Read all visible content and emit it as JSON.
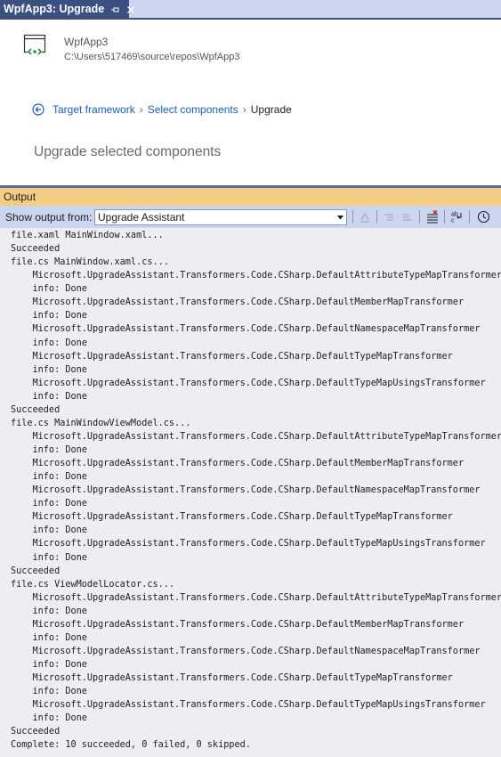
{
  "tab": {
    "title": "WpfApp3: Upgrade",
    "pin_icon": "pin-icon",
    "close_icon": "close-icon",
    "accent": "#3b4f81"
  },
  "project": {
    "icon": "wpf-project-icon",
    "name": "WpfApp3",
    "path": "C:\\Users\\517469\\source\\repos\\WpfApp3"
  },
  "breadcrumb": {
    "back_icon": "back-arrow-icon",
    "items": [
      "Target framework",
      "Select components",
      "Upgrade"
    ],
    "separator": "›"
  },
  "step_title": "Upgrade selected components",
  "output": {
    "title": "Output",
    "title_bg": "#f5cc84",
    "show_label": "Show output from:",
    "source": "Upgrade Assistant",
    "toolbar_icons": [
      "find-message-icon",
      "previous-message-icon",
      "next-message-icon",
      "clear-all-icon",
      "toggle-word-wrap-icon",
      "toggle-timestamp-icon"
    ],
    "lines": [
      "file.xaml MainWindow.xaml...",
      "Succeeded",
      "file.cs MainWindow.xaml.cs...",
      "    Microsoft.UpgradeAssistant.Transformers.Code.CSharp.DefaultAttributeTypeMapTransformer",
      "    info: Done",
      "    Microsoft.UpgradeAssistant.Transformers.Code.CSharp.DefaultMemberMapTransformer",
      "    info: Done",
      "    Microsoft.UpgradeAssistant.Transformers.Code.CSharp.DefaultNamespaceMapTransformer",
      "    info: Done",
      "    Microsoft.UpgradeAssistant.Transformers.Code.CSharp.DefaultTypeMapTransformer",
      "    info: Done",
      "    Microsoft.UpgradeAssistant.Transformers.Code.CSharp.DefaultTypeMapUsingsTransformer",
      "    info: Done",
      "Succeeded",
      "file.cs MainWindowViewModel.cs...",
      "    Microsoft.UpgradeAssistant.Transformers.Code.CSharp.DefaultAttributeTypeMapTransformer",
      "    info: Done",
      "    Microsoft.UpgradeAssistant.Transformers.Code.CSharp.DefaultMemberMapTransformer",
      "    info: Done",
      "    Microsoft.UpgradeAssistant.Transformers.Code.CSharp.DefaultNamespaceMapTransformer",
      "    info: Done",
      "    Microsoft.UpgradeAssistant.Transformers.Code.CSharp.DefaultTypeMapTransformer",
      "    info: Done",
      "    Microsoft.UpgradeAssistant.Transformers.Code.CSharp.DefaultTypeMapUsingsTransformer",
      "    info: Done",
      "Succeeded",
      "file.cs ViewModelLocator.cs...",
      "    Microsoft.UpgradeAssistant.Transformers.Code.CSharp.DefaultAttributeTypeMapTransformer",
      "    info: Done",
      "    Microsoft.UpgradeAssistant.Transformers.Code.CSharp.DefaultMemberMapTransformer",
      "    info: Done",
      "    Microsoft.UpgradeAssistant.Transformers.Code.CSharp.DefaultNamespaceMapTransformer",
      "    info: Done",
      "    Microsoft.UpgradeAssistant.Transformers.Code.CSharp.DefaultTypeMapTransformer",
      "    info: Done",
      "    Microsoft.UpgradeAssistant.Transformers.Code.CSharp.DefaultTypeMapUsingsTransformer",
      "    info: Done",
      "Succeeded",
      "Complete: 10 succeeded, 0 failed, 0 skipped."
    ]
  }
}
